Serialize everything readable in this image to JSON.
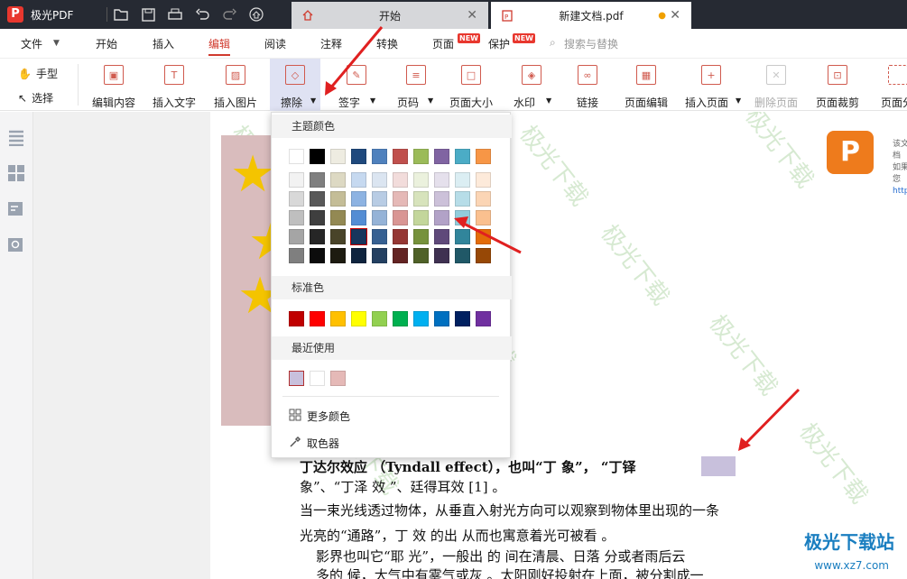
{
  "app": {
    "name": "极光PDF"
  },
  "tabs": [
    {
      "label": "开始"
    },
    {
      "label": "新建文档.pdf"
    }
  ],
  "menu": {
    "items": [
      "文件",
      "开始",
      "插入",
      "编辑",
      "阅读",
      "注释",
      "转换",
      "页面",
      "保护"
    ],
    "new_badge": "NEW",
    "search_placeholder": "搜索与替换"
  },
  "toolbar": {
    "hand": "手型",
    "select": "选择",
    "tools": [
      "编辑内容",
      "插入文字",
      "插入图片",
      "擦除",
      "签字",
      "页码",
      "页面大小",
      "水印",
      "链接",
      "页面编辑",
      "插入页面",
      "删除页面",
      "页面裁剪",
      "页面分"
    ]
  },
  "dropdown": {
    "theme_colors_title": "主题颜色",
    "standard_colors_title": "标准色",
    "recent_title": "最近使用",
    "more_colors": "更多颜色",
    "color_picker": "取色器",
    "theme_top": [
      "#ffffff",
      "#000000",
      "#eeece1",
      "#1f497d",
      "#4f81bd",
      "#c0504d",
      "#9bbb59",
      "#8064a2",
      "#4bacc6",
      "#f79646"
    ],
    "theme_rows": [
      [
        "#f2f2f2",
        "#7f7f7f",
        "#ddd9c3",
        "#c6d9f0",
        "#dbe5f1",
        "#f2dcdb",
        "#ebf1dd",
        "#e5e0ec",
        "#dbeef3",
        "#fdeada"
      ],
      [
        "#d8d8d8",
        "#595959",
        "#c4bd97",
        "#8db3e2",
        "#b8cce4",
        "#e5b9b7",
        "#d7e3bc",
        "#ccc1d9",
        "#b7dde8",
        "#fbd5b5"
      ],
      [
        "#bfbfbf",
        "#3f3f3f",
        "#938953",
        "#548dd4",
        "#95b3d7",
        "#d99694",
        "#c3d69b",
        "#b2a2c7",
        "#92cddc",
        "#fac08f"
      ],
      [
        "#a5a5a5",
        "#262626",
        "#494429",
        "#17365d",
        "#366092",
        "#953734",
        "#76923c",
        "#5f497a",
        "#31859b",
        "#e36c09"
      ],
      [
        "#7f7f7f",
        "#0c0c0c",
        "#1d1b10",
        "#0f243e",
        "#244061",
        "#632423",
        "#4f6128",
        "#3f3151",
        "#205867",
        "#974806"
      ]
    ],
    "standard": [
      "#c00000",
      "#ff0000",
      "#ffc000",
      "#ffff00",
      "#92d050",
      "#00b050",
      "#00b0f0",
      "#0070c0",
      "#002060",
      "#7030a0"
    ],
    "recent": [
      "#c8c0dc",
      "#ffffff",
      "#e5b9b7"
    ]
  },
  "watermark": {
    "text": "极光下载",
    "site_name": "极光下载站",
    "url": "www.xz7.com"
  },
  "document": {
    "line1": "丁达尔效应  （Tyndall effect），也叫“丁     象”，    “丁铎",
    "line2": "象”、“丁泽  效  ”、廷得耳效   [1] 。",
    "line3": "当一束光线透过物体，从垂直入射光方向可以观察到物体里出现的一条",
    "line4": "光亮的“通路”，丁   效  的出  从而也寓意着光可被看  。",
    "line5": "影界也叫它“耶  光”，一般出  的  间在清晨、日落  分或者雨后云",
    "line6": "多的  候，大气中有雾气或灰  。太阳刚好投射在上面，被分割成一"
  },
  "side_note": {
    "l1": "该文档",
    "l2": "如果您",
    "l3": "http:/"
  }
}
